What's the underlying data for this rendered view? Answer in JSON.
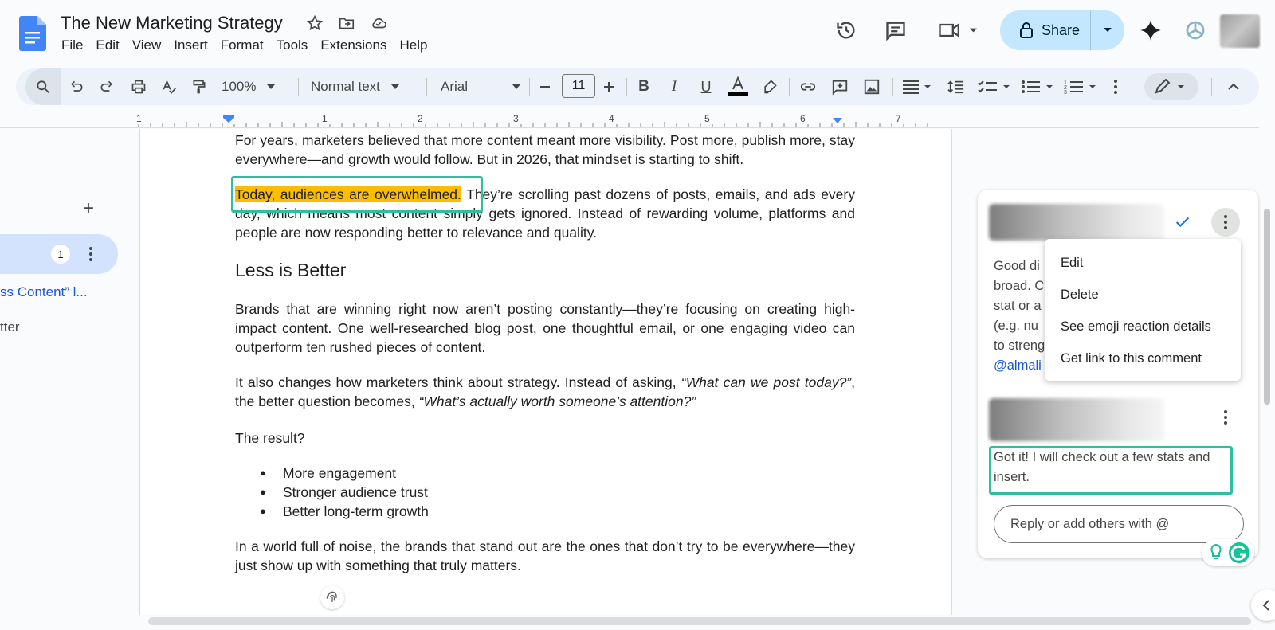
{
  "app": {
    "title": "The New Marketing Strategy",
    "menu": [
      "File",
      "Edit",
      "View",
      "Insert",
      "Format",
      "Tools",
      "Extensions",
      "Help"
    ],
    "share_label": "Share"
  },
  "toolbar": {
    "zoom": "100%",
    "style": "Normal text",
    "font": "Arial",
    "font_size": "11"
  },
  "ruler": {
    "marks": [
      "1",
      "1",
      "2",
      "3",
      "4",
      "5",
      "6",
      "7"
    ]
  },
  "outline": {
    "badge_count": "1",
    "link_text": "ss Content” l...",
    "item_text": "tter"
  },
  "document": {
    "p1": "For years, marketers believed that more content meant more visibility. Post more, publish more, stay everywhere—and growth would follow. But in 2026, that mindset is starting to shift.",
    "p2_highlight": "Today, audiences are overwhelmed.",
    "p2_rest": " They’re scrolling past dozens of posts, emails, and ads every day, which means most content simply gets ignored. Instead of rewarding volume, platforms and people are now responding better to relevance and quality.",
    "heading": "Less is Better",
    "p3": "Brands that are winning right now aren’t posting constantly—they’re focusing on creating high-impact content. One well-researched blog post, one thoughtful email, or one engaging video can outperform ten rushed pieces of content.",
    "p4_a": "It also changes how marketers think about strategy. Instead of asking, ",
    "p4_q1": "“What can we post today?”",
    "p4_b": ", the better question becomes, ",
    "p4_q2": "“What’s actually worth someone’s attention?”",
    "p5": "The result?",
    "bullets": [
      "More engagement",
      "Stronger audience trust",
      "Better long-term growth"
    ],
    "p6": "In a world full of noise, the brands that stand out are the ones that don’t try to be everywhere—they just show up with something that truly matters."
  },
  "comments": {
    "c1_lines": [
      "Good di",
      "broad. C",
      "stat or a",
      "(e.g. nu",
      "to streng"
    ],
    "c1_mention": "@almali",
    "reply_text": "Got it! I will check out a few stats and insert.",
    "reply_placeholder": "Reply or add others with @"
  },
  "context_menu": [
    "Edit",
    "Delete",
    "See emoji reaction details",
    "Get link to this comment"
  ],
  "colors": {
    "highlight": "#fbbc04",
    "annotation": "#2ebf9f",
    "share_bg": "#c2e7ff",
    "toolbar_bg": "#edf2fa"
  }
}
